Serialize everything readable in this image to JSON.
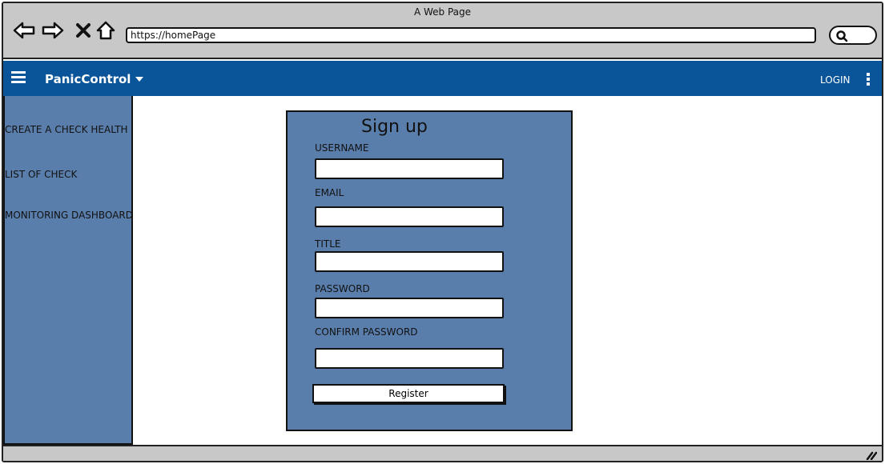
{
  "browser": {
    "window_title": "A Web Page",
    "url": "https://homePage",
    "icons": [
      "back-icon",
      "forward-icon",
      "close-icon",
      "home-icon",
      "search-icon"
    ]
  },
  "app_bar": {
    "brand": "PanicControl",
    "login": "LOGIN",
    "color": "#0a5599"
  },
  "sidebar": {
    "items": [
      {
        "label": "CREATE A CHECK HEALTH"
      },
      {
        "label": "LIST OF CHECK"
      },
      {
        "label": "MONITORING DASHBOARD"
      }
    ]
  },
  "signup": {
    "title": "Sign up",
    "fields": [
      {
        "label": "USERNAME",
        "value": ""
      },
      {
        "label": "EMAIL",
        "value": ""
      },
      {
        "label": "TITLE",
        "value": ""
      },
      {
        "label": "PASSWORD",
        "value": ""
      },
      {
        "label": "CONFIRM PASSWORD",
        "value": ""
      }
    ],
    "register_label": "Register"
  },
  "colors": {
    "panel": "#5a7eab",
    "chrome": "#c8c8c8"
  }
}
